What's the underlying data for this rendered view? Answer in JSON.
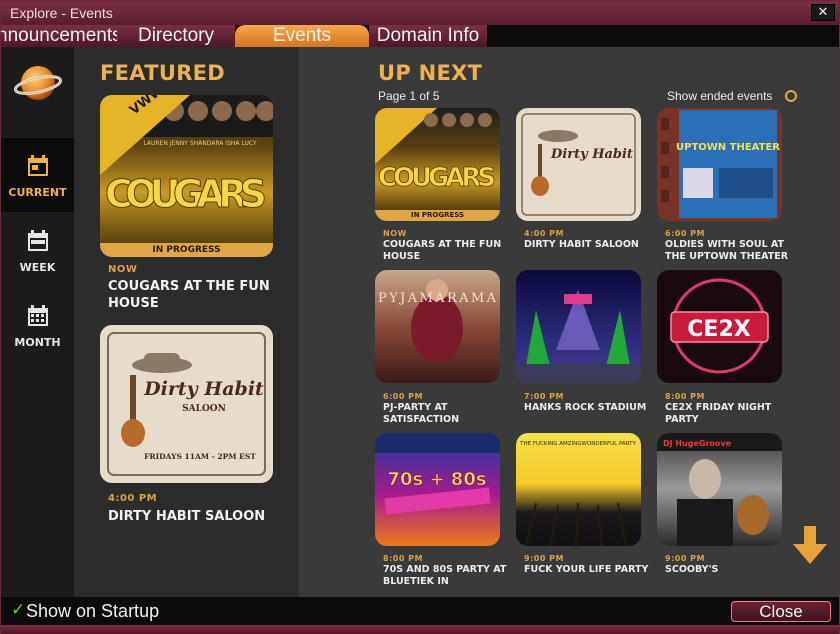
{
  "window": {
    "title": "Explore - Events",
    "close_glyph": "✕"
  },
  "tabs": [
    {
      "label": "Announcements",
      "visible": "nnouncements"
    },
    {
      "label": "Directory"
    },
    {
      "label": "Events"
    },
    {
      "label": "Domain Info"
    }
  ],
  "nav": [
    {
      "label": "CURRENT",
      "icon": "calendar-day-icon"
    },
    {
      "label": "WEEK",
      "icon": "calendar-week-icon"
    },
    {
      "label": "MONTH",
      "icon": "calendar-month-icon"
    }
  ],
  "featured": {
    "title": "FEATURED",
    "items": [
      {
        "when": "NOW",
        "name": "COUGARS AT THE FUN HOUSE",
        "status": "IN PROGRESS",
        "art": {
          "big": "COUGARS",
          "badge": "VWW OF THE DAY",
          "names": "LAUREN  JENNY  SHANDARA  ISHA  LUCY"
        }
      },
      {
        "when": "4:00 PM",
        "name": "DIRTY HABIT SALOON",
        "art": {
          "big": "Dirty Habit",
          "sub": "SALOON",
          "foot": "FRIDAYS 11AM - 2PM EST"
        }
      }
    ]
  },
  "upnext": {
    "title": "UP NEXT",
    "page": "Page 1 of 5",
    "show_ended": "Show ended events",
    "items": [
      {
        "when": "NOW",
        "name": "COUGARS AT THE FUN HOUSE",
        "status": "IN PROGRESS",
        "art": "COUGARS"
      },
      {
        "when": "4:00 PM",
        "name": "DIRTY HABIT SALOON",
        "art": "Dirty Habit"
      },
      {
        "when": "6:00 PM",
        "name": "OLDIES WITH SOUL AT THE UPTOWN THEATER",
        "art": "UPTOWN THEATER"
      },
      {
        "when": "6:00 PM",
        "name": "PJ-PARTY AT SATISFACTION",
        "art": "PYJAMARAMA"
      },
      {
        "when": "7:00 PM",
        "name": "HANKS ROCK STADIUM",
        "art": ""
      },
      {
        "when": "8:00 PM",
        "name": "CE2X FRIDAY NIGHT PARTY",
        "art": "CE2X"
      },
      {
        "when": "8:00 PM",
        "name": "70S AND 80S PARTY AT BLUETIEK IN",
        "art": "70s + 80s"
      },
      {
        "when": "9:00 PM",
        "name": "FUCK YOUR LIFE PARTY",
        "art": "THE FUCKING AMZINGWONDERFUL PARTY"
      },
      {
        "when": "9:00 PM",
        "name": "SCOOBY'S",
        "art": "DJ HugeGroove"
      }
    ]
  },
  "footer": {
    "check": "✓",
    "startup": "Show on Startup",
    "close": "Close"
  },
  "colors": {
    "accent": "#f0b24b",
    "tab_active": "#e8892f",
    "frame": "#6a2a3c"
  }
}
